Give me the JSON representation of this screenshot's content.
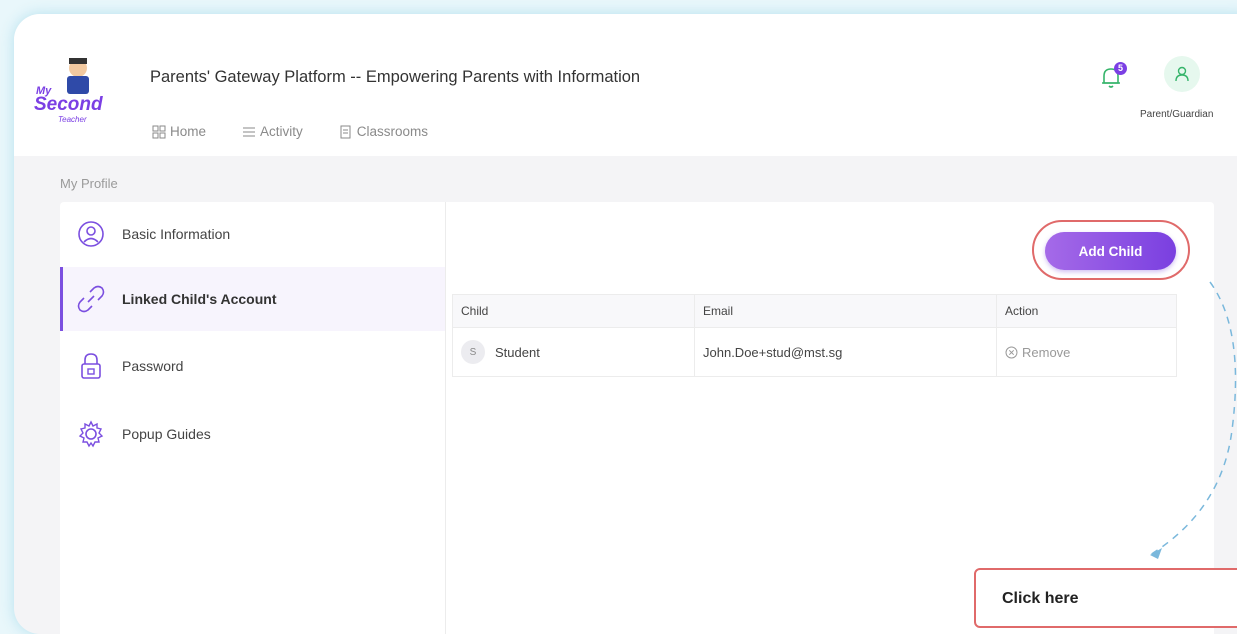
{
  "app": {
    "title": "Parents' Gateway Platform -- Empowering Parents with Information",
    "logo_text": "My Second Teacher"
  },
  "nav": [
    {
      "label": "Home",
      "icon": "grid-icon"
    },
    {
      "label": "Activity",
      "icon": "list-icon"
    },
    {
      "label": "Classrooms",
      "icon": "document-icon"
    }
  ],
  "notifications": {
    "count": "5",
    "icon": "bell-icon"
  },
  "user": {
    "role": "Parent/Guardian",
    "icon": "user-icon"
  },
  "breadcrumb": "My Profile",
  "sidebar": {
    "items": [
      {
        "label": "Basic Information",
        "icon": "user-circle-icon"
      },
      {
        "label": "Linked Child's Account",
        "icon": "link-icon",
        "active": true
      },
      {
        "label": "Password",
        "icon": "lock-icon"
      },
      {
        "label": "Popup Guides",
        "icon": "gear-icon"
      }
    ]
  },
  "actions": {
    "add_child_label": "Add Child"
  },
  "table": {
    "headers": [
      "Child",
      "Email",
      "Action"
    ],
    "rows": [
      {
        "initial": "S",
        "child": "Student",
        "email": "John.Doe+stud@mst.sg",
        "action": "Remove"
      }
    ]
  },
  "callout": {
    "text": "Click here"
  },
  "colors": {
    "accent": "#7b3fe4",
    "annotation": "#e06a6a",
    "arrow": "#7ab8dc"
  }
}
